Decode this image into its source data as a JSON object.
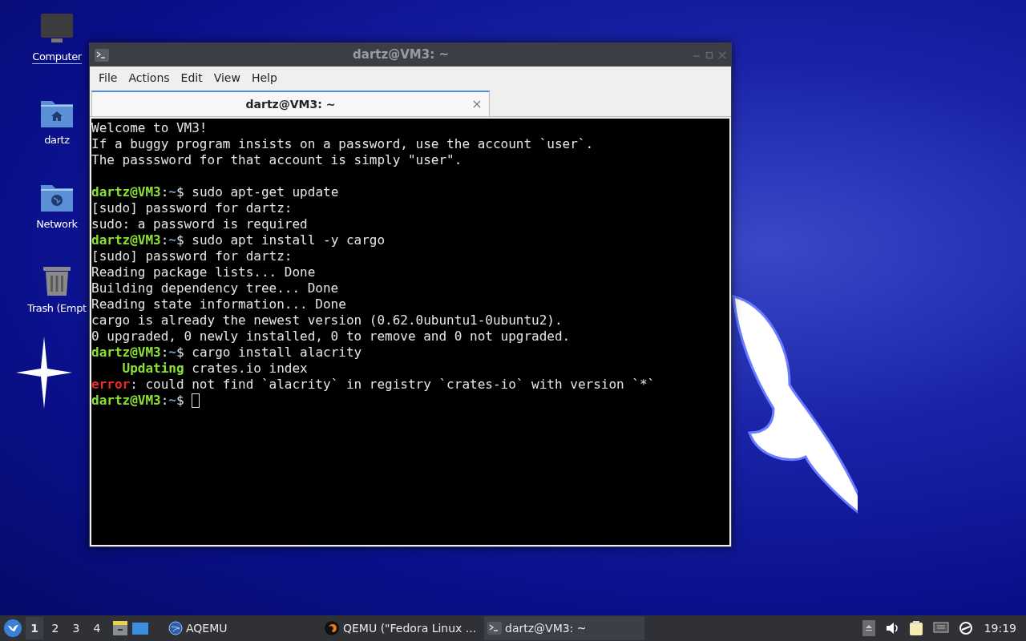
{
  "desktop_icons": [
    {
      "kind": "computer",
      "label": "Computer",
      "selected": true
    },
    {
      "kind": "home",
      "label": "dartz",
      "selected": false
    },
    {
      "kind": "network",
      "label": "Network",
      "selected": false
    },
    {
      "kind": "trash",
      "label": "Trash (Empt",
      "selected": false
    }
  ],
  "window": {
    "title": "dartz@VM3: ~",
    "menu": [
      "File",
      "Actions",
      "Edit",
      "View",
      "Help"
    ],
    "tabs": [
      {
        "label": "dartz@VM3: ~",
        "selected": true
      }
    ],
    "terminal": {
      "lines": [
        {
          "segments": [
            {
              "kind": "plain",
              "text": "Welcome to VM3!"
            }
          ]
        },
        {
          "segments": [
            {
              "kind": "plain",
              "text": "If a buggy program insists on a password, use the account `user`."
            }
          ]
        },
        {
          "segments": [
            {
              "kind": "plain",
              "text": "The passsword for that account is simply \"user\"."
            }
          ]
        },
        {
          "kind": "blank"
        },
        {
          "segments": [
            {
              "kind": "user",
              "text": "dartz@VM3"
            },
            {
              "kind": "plain",
              "text": ":"
            },
            {
              "kind": "path",
              "text": "~"
            },
            {
              "kind": "plain",
              "text": "$ sudo apt-get update"
            }
          ]
        },
        {
          "segments": [
            {
              "kind": "plain",
              "text": "[sudo] password for dartz:"
            }
          ]
        },
        {
          "segments": [
            {
              "kind": "plain",
              "text": "sudo: a password is required"
            }
          ]
        },
        {
          "segments": [
            {
              "kind": "user",
              "text": "dartz@VM3"
            },
            {
              "kind": "plain",
              "text": ":"
            },
            {
              "kind": "path",
              "text": "~"
            },
            {
              "kind": "plain",
              "text": "$ sudo apt install -y cargo"
            }
          ]
        },
        {
          "segments": [
            {
              "kind": "plain",
              "text": "[sudo] password for dartz:"
            }
          ]
        },
        {
          "segments": [
            {
              "kind": "plain",
              "text": "Reading package lists... Done"
            }
          ]
        },
        {
          "segments": [
            {
              "kind": "plain",
              "text": "Building dependency tree... Done"
            }
          ]
        },
        {
          "segments": [
            {
              "kind": "plain",
              "text": "Reading state information... Done"
            }
          ]
        },
        {
          "segments": [
            {
              "kind": "plain",
              "text": "cargo is already the newest version (0.62.0ubuntu1-0ubuntu2)."
            }
          ]
        },
        {
          "segments": [
            {
              "kind": "plain",
              "text": "0 upgraded, 0 newly installed, 0 to remove and 0 not upgraded."
            }
          ]
        },
        {
          "segments": [
            {
              "kind": "user",
              "text": "dartz@VM3"
            },
            {
              "kind": "plain",
              "text": ":"
            },
            {
              "kind": "path",
              "text": "~"
            },
            {
              "kind": "plain",
              "text": "$ cargo install alacrity"
            }
          ]
        },
        {
          "segments": [
            {
              "kind": "status",
              "text": "    Updating"
            },
            {
              "kind": "plain",
              "text": " crates.io index"
            }
          ]
        },
        {
          "segments": [
            {
              "kind": "error",
              "text": "error"
            },
            {
              "kind": "plain",
              "text": ": could not find `alacrity` in registry `crates-io` with version `*`"
            }
          ]
        },
        {
          "segments": [
            {
              "kind": "user",
              "text": "dartz@VM3"
            },
            {
              "kind": "plain",
              "text": ":"
            },
            {
              "kind": "path",
              "text": "~"
            },
            {
              "kind": "plain",
              "text": "$ "
            }
          ],
          "cursor": true
        }
      ]
    }
  },
  "taskbar": {
    "workspaces": [
      {
        "label": "1",
        "selected": true
      },
      {
        "label": "2",
        "selected": false
      },
      {
        "label": "3",
        "selected": false
      },
      {
        "label": "4",
        "selected": false
      }
    ],
    "tasks": [
      {
        "kind": "aqemu",
        "label": "AQEMU",
        "selected": false
      },
      {
        "kind": "qemu",
        "label": "QEMU (\"Fedora Linux ...",
        "selected": false
      },
      {
        "kind": "terminal",
        "label": "dartz@VM3: ~",
        "selected": true
      }
    ],
    "clock": "19:19"
  }
}
